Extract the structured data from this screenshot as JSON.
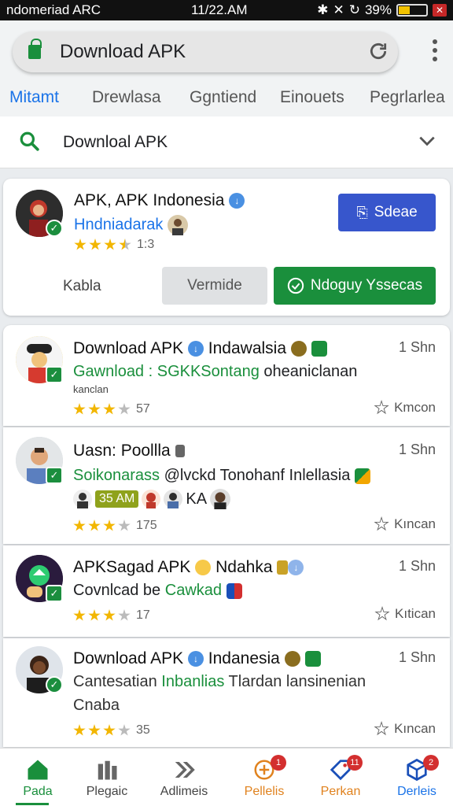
{
  "status_bar": {
    "carrier": "ndomeriad ARC",
    "time": "11/22.AM",
    "battery": "39%",
    "battery_level": 0.39
  },
  "browser": {
    "url_title": "Download APK"
  },
  "tabs": [
    {
      "label": "Mitamt",
      "active": true
    },
    {
      "label": "Drewlasa",
      "active": false
    },
    {
      "label": "Ggntiend",
      "active": false
    },
    {
      "label": "Einouets",
      "active": false
    },
    {
      "label": "Pegrlarlea",
      "active": false
    }
  ],
  "search": {
    "text": "Downloal APK"
  },
  "featured": {
    "title": "APK, APK Indonesia",
    "subtitle": "Hndniadarak",
    "rating_text": "1:3",
    "stars": 3.5,
    "action_button": "Sdeae",
    "btn_left": "Kabla",
    "btn_middle": "Vermide",
    "btn_primary": "Ndoguy Yssecas"
  },
  "items": [
    {
      "title": "Download APK",
      "title_extra": "Indawalsia",
      "time": "1 Shn",
      "line1_green": "Gawnload : SGKKSontang",
      "line1_rest": " oheaniclanan",
      "line2": "kanclan",
      "rating": "57",
      "stars": 3,
      "action": "Kmcon"
    },
    {
      "title": "Uasn: Poollla",
      "time": "1 Shn",
      "line1_green": "Soikonarass",
      "line1_rest": " @lvckd Tonohanf Inlellasia",
      "chip": "35 AM",
      "chip_suffix": "KA",
      "rating": "175",
      "stars": 3,
      "action": "Kıncan"
    },
    {
      "title": "APKSagad APK",
      "title_extra": "Ndahka",
      "time": "1 Shn",
      "line1_rest": "Covnlcad be ",
      "line1_green": "Cawkad",
      "rating": "17",
      "stars": 3,
      "action": "Kıtican"
    },
    {
      "title": "Download APK",
      "title_extra": "Indanesia",
      "time": "1 Shn",
      "line1_rest": "Cantesatian ",
      "line1_green": "Inbanlias",
      "line1_tail": " Tlardan lansinenian",
      "line2": "Cnaba",
      "rating": "35",
      "stars": 3,
      "action": "Kıncan"
    }
  ],
  "bottom_nav": [
    {
      "label": "Pada",
      "icon": "home-icon",
      "active": true,
      "color": "#1a8f3c"
    },
    {
      "label": "Plegaic",
      "icon": "apps-icon",
      "active": false,
      "color": "#555555"
    },
    {
      "label": "Adlimeis",
      "icon": "forward-icon",
      "active": false,
      "color": "#555555"
    },
    {
      "label": "Pellelis",
      "icon": "games-icon",
      "active": false,
      "badge": "1",
      "color": "#e0821e"
    },
    {
      "label": "Perkan",
      "icon": "tag-icon",
      "active": false,
      "badge": "11",
      "color": "#e0821e"
    },
    {
      "label": "Derleis",
      "icon": "cube-icon",
      "active": false,
      "badge": "2",
      "color": "#1a73e8"
    }
  ]
}
